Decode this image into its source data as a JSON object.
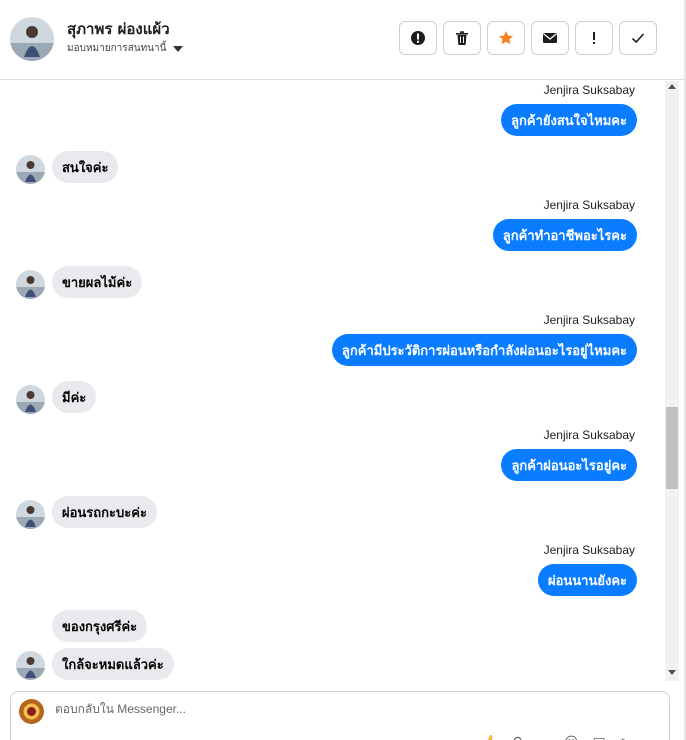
{
  "header": {
    "contact_name": "สุภาพร ผ่องแผ้ว",
    "assign_label": "มอบหมายการสนทนานี้",
    "actions": [
      {
        "name": "spam",
        "icon": "alert-circle-icon"
      },
      {
        "name": "delete",
        "icon": "trash-icon"
      },
      {
        "name": "star",
        "icon": "star-icon"
      },
      {
        "name": "mark-unread",
        "icon": "envelope-icon"
      },
      {
        "name": "follow-up",
        "icon": "exclamation-icon"
      },
      {
        "name": "done",
        "icon": "check-icon"
      }
    ],
    "star_color": "#f5821f"
  },
  "messages": {
    "m1": {
      "sender": "Jenjira Suksabay",
      "text": "ลูกค้ายังสนใจไหมคะ"
    },
    "m2": {
      "text": "สนใจค่ะ"
    },
    "m3": {
      "sender": "Jenjira Suksabay",
      "text": "ลูกค้าทำอาชีพอะไรคะ"
    },
    "m4": {
      "text": "ขายผลไม้ค่ะ"
    },
    "m5": {
      "sender": "Jenjira Suksabay",
      "text": "ลูกค้ามีประวัติการผ่อนหรือกำลังผ่อนอะไรอยู่ไหมคะ"
    },
    "m6": {
      "text": "มีค่ะ"
    },
    "m7": {
      "sender": "Jenjira Suksabay",
      "text": "ลูกค้าผ่อนอะไรอยู่คะ"
    },
    "m8": {
      "text": "ผ่อนรถกะบะค่ะ"
    },
    "m9": {
      "sender": "Jenjira Suksabay",
      "text": "ผ่อนนานยังคะ"
    },
    "m10": {
      "text": "ของกรุงศรีค่ะ"
    },
    "m11": {
      "text": "ใกล้จะหมดแล้วค่ะ"
    }
  },
  "composer": {
    "placeholder": "ตอบกลับใน Messenger..."
  },
  "colors": {
    "outgoing_bubble": "#0a7cff",
    "incoming_bubble": "#e9eaed"
  }
}
